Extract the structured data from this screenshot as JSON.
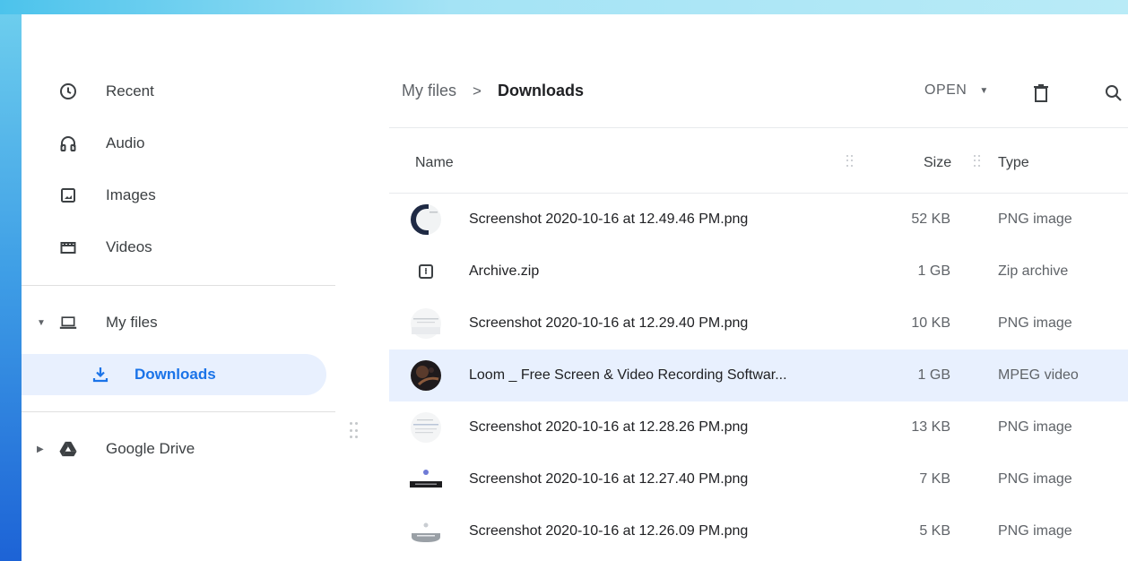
{
  "sidebar": {
    "items": [
      {
        "label": "Recent",
        "icon": "clock-icon"
      },
      {
        "label": "Audio",
        "icon": "headphones-icon"
      },
      {
        "label": "Images",
        "icon": "image-icon"
      },
      {
        "label": "Videos",
        "icon": "film-icon"
      },
      {
        "label": "My files",
        "icon": "laptop-icon"
      },
      {
        "label": "Downloads",
        "icon": "download-icon"
      },
      {
        "label": "Google Drive",
        "icon": "drive-icon"
      }
    ]
  },
  "breadcrumb": {
    "root": "My files",
    "separator": ">",
    "current": "Downloads"
  },
  "toolbar": {
    "open_label": "OPEN",
    "delete_icon": "trash-icon",
    "search_icon": "search-icon"
  },
  "columns": {
    "name": "Name",
    "size": "Size",
    "type": "Type"
  },
  "files": [
    {
      "name": "Screenshot 2020-10-16 at 12.49.46 PM.png",
      "size": "52 KB",
      "type": "PNG image",
      "thumb": "screenshot-thumb"
    },
    {
      "name": "Archive.zip",
      "size": "1 GB",
      "type": "Zip archive",
      "thumb": "zip-icon"
    },
    {
      "name": "Screenshot 2020-10-16 at 12.29.40 PM.png",
      "size": "10 KB",
      "type": "PNG image",
      "thumb": "screenshot-thumb"
    },
    {
      "name": "Loom _ Free Screen & Video Recording Softwar...",
      "size": "1 GB",
      "type": "MPEG video",
      "thumb": "video-thumb",
      "selected": true
    },
    {
      "name": "Screenshot 2020-10-16 at 12.28.26 PM.png",
      "size": "13 KB",
      "type": "PNG image",
      "thumb": "screenshot-thumb"
    },
    {
      "name": "Screenshot 2020-10-16 at 12.27.40 PM.png",
      "size": "7 KB",
      "type": "PNG image",
      "thumb": "screenshot-thumb"
    },
    {
      "name": "Screenshot 2020-10-16 at 12.26.09 PM.png",
      "size": "5 KB",
      "type": "PNG image",
      "thumb": "screenshot-thumb"
    }
  ],
  "colors": {
    "accent": "#1a73e8",
    "selected_bg": "#e8f0fe"
  }
}
